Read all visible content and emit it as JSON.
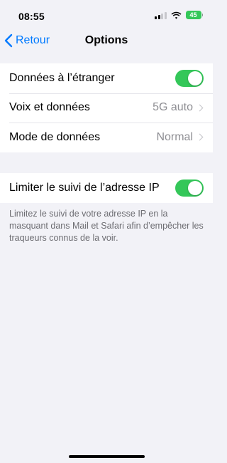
{
  "status_bar": {
    "time": "08:55",
    "battery": "45",
    "battery_color": "#34c759",
    "icons": [
      "signal-icon",
      "wifi-icon",
      "battery-icon"
    ]
  },
  "nav": {
    "back_label": "Retour",
    "title": "Options",
    "accent_color": "#007aff"
  },
  "group1": {
    "roaming": {
      "label": "Données à l’étranger",
      "toggle_on": true
    },
    "voice_data": {
      "label": "Voix et données",
      "value": "5G auto"
    },
    "data_mode": {
      "label": "Mode de données",
      "value": "Normal"
    }
  },
  "group2": {
    "limit_ip": {
      "label": "Limiter le suivi de l’adresse IP",
      "toggle_on": true
    },
    "footer": "Limitez le suivi de votre adresse IP en la masquant dans Mail et Safari afin d’empêcher les traqueurs connus de la voir."
  }
}
